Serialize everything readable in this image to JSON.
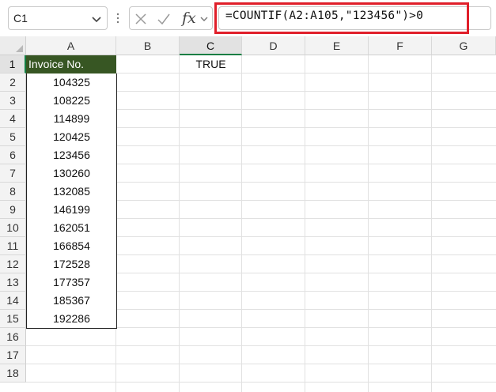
{
  "name_box": {
    "value": "C1"
  },
  "formula_bar": {
    "fx_label": "fx",
    "formula": "=COUNTIF(A2:A105,\"123456\")>0"
  },
  "columns": [
    "A",
    "B",
    "C",
    "D",
    "E",
    "F",
    "G"
  ],
  "rows": [
    "1",
    "2",
    "3",
    "4",
    "5",
    "6",
    "7",
    "8",
    "9",
    "10",
    "11",
    "12",
    "13",
    "14",
    "15",
    "16",
    "17",
    "18"
  ],
  "cells": {
    "A1": "Invoice No.",
    "C1": "TRUE",
    "invoice_values": [
      "104325",
      "108225",
      "114899",
      "120425",
      "123456",
      "130260",
      "132085",
      "146199",
      "162051",
      "166854",
      "172528",
      "177357",
      "185367",
      "192286"
    ]
  },
  "colors": {
    "header_fill": "#375623",
    "highlight_border": "#e01f2a",
    "selection_accent": "#137e43"
  }
}
